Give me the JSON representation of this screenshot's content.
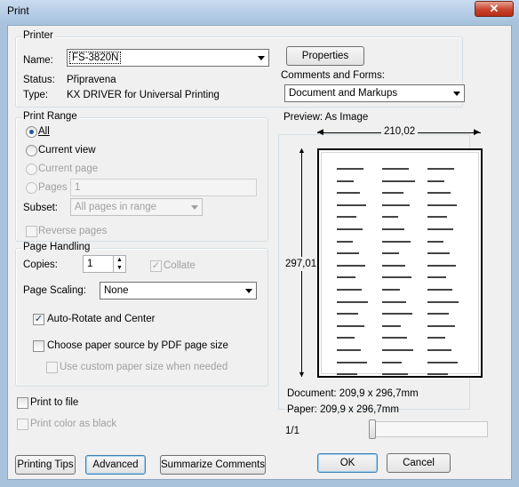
{
  "window": {
    "title": "Print",
    "close_label": "✕"
  },
  "printer": {
    "group_label": "Printer",
    "name_label": "Name:",
    "name_value": "FS-3820N",
    "status_label": "Status:",
    "status_value": "Připravena",
    "type_label": "Type:",
    "type_value": "KX DRIVER for Universal Printing",
    "properties_label": "Properties",
    "comments_label": "Comments and Forms:",
    "comments_value": "Document and Markups"
  },
  "print_range": {
    "group_label": "Print Range",
    "all_label": "All",
    "current_view_label": "Current view",
    "current_page_label": "Current page",
    "pages_label": "Pages",
    "pages_value": "1",
    "subset_label": "Subset:",
    "subset_value": "All pages in range",
    "reverse_label": "Reverse pages"
  },
  "page_handling": {
    "group_label": "Page Handling",
    "copies_label": "Copies:",
    "copies_value": "1",
    "collate_label": "Collate",
    "scaling_label": "Page Scaling:",
    "scaling_value": "None",
    "auto_rotate_label": "Auto-Rotate and Center",
    "paper_source_label": "Choose paper source by PDF page size",
    "custom_size_label": "Use custom paper size when needed"
  },
  "print_to_file_label": "Print to file",
  "print_color_black_label": "Print color as black",
  "preview": {
    "group_label": "Preview: As Image",
    "width_value": "210,02",
    "height_value": "297,01",
    "document_size": "Document: 209,9 x 296,7mm",
    "paper_size": "Paper: 209,9 x 296,7mm",
    "page_counter": "1/1",
    "slider_position": 0
  },
  "buttons": {
    "printing_tips": "Printing Tips",
    "advanced": "Advanced",
    "summarize": "Summarize Comments",
    "ok": "OK",
    "cancel": "Cancel"
  }
}
